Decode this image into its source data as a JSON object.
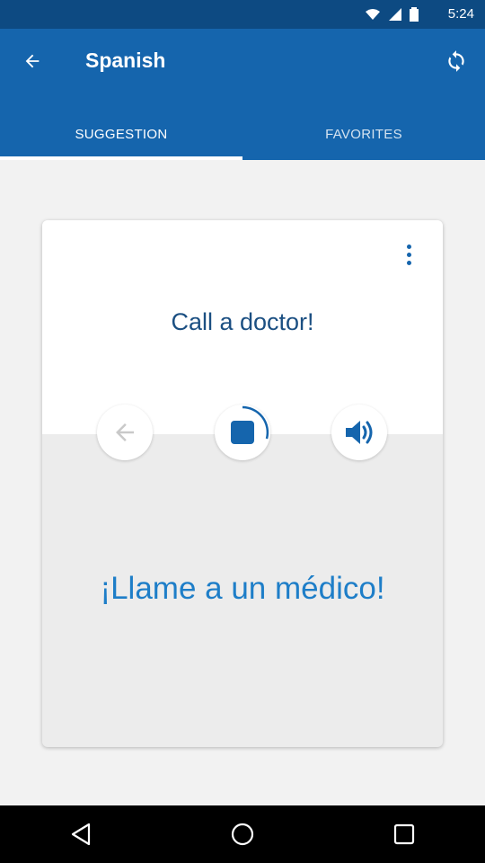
{
  "status_bar": {
    "time": "5:24"
  },
  "app_bar": {
    "title": "Spanish",
    "back_icon": "arrow-back-icon",
    "refresh_icon": "refresh-icon"
  },
  "tabs": [
    {
      "label": "SUGGESTION",
      "active": true
    },
    {
      "label": "FAVORITES",
      "active": false
    }
  ],
  "card": {
    "phrase": "Call a doctor!",
    "translation": "¡Llame a un médico!",
    "controls": [
      "previous-arrow-icon",
      "stop-icon",
      "volume-icon"
    ],
    "more_icon": "more-vertical-icon"
  },
  "colors": {
    "status_bar": "#0d4a82",
    "app_bar": "#1565ad",
    "phrase_text": "#1b4f82",
    "translation_text": "#1e7ec8",
    "background": "#f2f2f2"
  }
}
